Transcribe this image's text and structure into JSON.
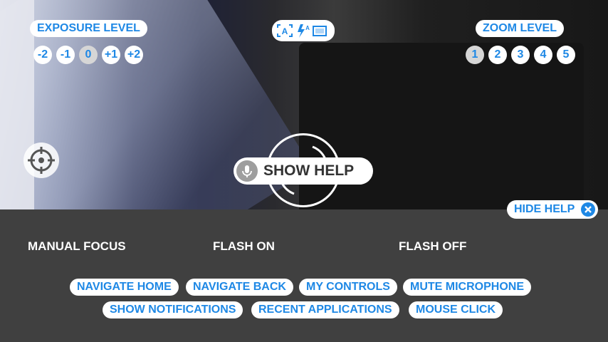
{
  "exposure": {
    "title": "EXPOSURE LEVEL",
    "levels": [
      "-2",
      "-1",
      "0",
      "+1",
      "+2"
    ],
    "selected": "0"
  },
  "zoom": {
    "title": "ZOOM LEVEL",
    "levels": [
      "1",
      "2",
      "3",
      "4",
      "5"
    ],
    "selected": "1"
  },
  "mode_icons": [
    "auto-focus-icon",
    "flash-auto-icon",
    "aspect-ratio-icon"
  ],
  "center": {
    "show_help_label": "SHOW HELP"
  },
  "hide_help_label": "HIDE HELP",
  "commands": {
    "manual_focus": "MANUAL FOCUS",
    "flash_on": "FLASH ON",
    "flash_off": "FLASH OFF"
  },
  "voice_commands": {
    "row1": [
      "NAVIGATE HOME",
      "NAVIGATE BACK",
      "MY CONTROLS",
      "MUTE MICROPHONE"
    ],
    "row2": [
      "SHOW NOTIFICATIONS",
      "RECENT APPLICATIONS",
      "MOUSE CLICK"
    ]
  },
  "colors": {
    "accent": "#1e88e5",
    "panel": "#404040",
    "pill": "#ffffff"
  }
}
